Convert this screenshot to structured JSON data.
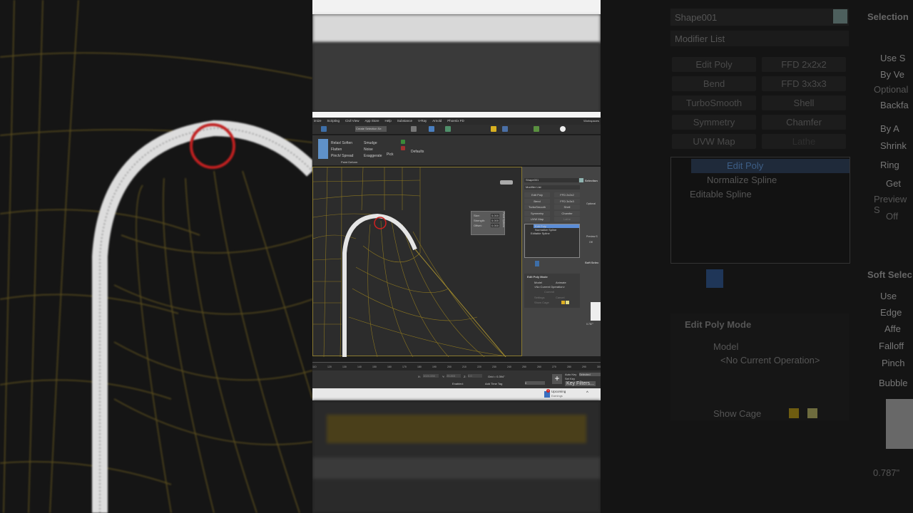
{
  "menu": [
    "imize",
    "Scripting",
    "Civil View",
    "App Store",
    "Help",
    "Substance",
    "V-Ray",
    "Arnold",
    "Phoenix FD"
  ],
  "workspaces": "Workspaces",
  "selection_set": "Create Selection Se",
  "ribbon": {
    "tools": [
      "Relax/ Soften",
      "Flatten",
      "Pinch/ Spread",
      "Smudge",
      "Noise",
      "Exaggerate"
    ],
    "pick": "Pick",
    "defaults": "Defaults",
    "group": "Paint Deform"
  },
  "paint_options": {
    "title": "Paint Options",
    "fields": [
      {
        "label": "Size:",
        "value": "5.000"
      },
      {
        "label": "Strength:",
        "value": "5.000"
      },
      {
        "label": "Offset:",
        "value": "0.000"
      }
    ]
  },
  "command_panel": {
    "object_name": "Shape001",
    "color": "#8fb3b0",
    "modifier_list": "Modifier List",
    "modifiers": [
      "Edit Poly",
      "FFD 2x2x2",
      "Bend",
      "FFD 3x3x3",
      "TurboSmooth",
      "Shell",
      "Symmetry",
      "Chamfer",
      "UVW Map",
      "Lathe"
    ],
    "stack": [
      "Edit Poly",
      "Normalize Spline",
      "Editable Spline"
    ],
    "edit_poly_mode": {
      "title": "Edit Poly Mode",
      "model": "Model",
      "animate": "Animate",
      "status": "<No Current Operation>",
      "commit": "Commit",
      "settings": "Settings",
      "cancel": "Cancel",
      "show_cage": "Show Cage"
    },
    "selection": {
      "title": "Selection",
      "optional": "Optional",
      "preview": "Preview S",
      "off": "Off",
      "items": [
        "Use S",
        "By Ve",
        "Backfa",
        "By A",
        "Shrink",
        "Ring",
        "Get"
      ]
    },
    "soft_selection": {
      "title": "Soft Selec",
      "items": [
        "Use",
        "Edge",
        "Affe",
        "Falloff",
        "Pinch",
        "Bubble"
      ],
      "value": "0.787\""
    }
  },
  "timeline": [
    "110",
    "120",
    "130",
    "140",
    "150",
    "160",
    "170",
    "180",
    "190",
    "200",
    "210",
    "220",
    "230",
    "240",
    "250",
    "260",
    "270",
    "280",
    "290",
    "300"
  ],
  "status": {
    "x_label": "X:",
    "x": "1024.335",
    "y_label": "Y:",
    "y": "25.803",
    "z_label": "Z:",
    "z": "0.0",
    "grid": "Grid = 0.394\"",
    "enabled": "Enabled:",
    "add_time_tag": "Add Time Tag",
    "frame": "0",
    "auto_key": "Auto Key",
    "set_key": "Set Key",
    "selected": "Selected",
    "key_filters": "Key Filters..."
  },
  "taskbar": {
    "badge": "1",
    "title": "Upcoming",
    "subtitle": "Earnings"
  }
}
